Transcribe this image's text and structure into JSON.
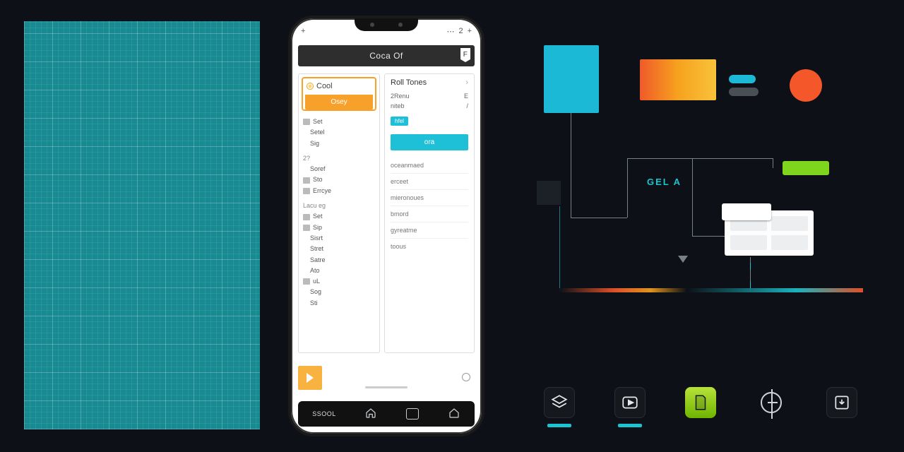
{
  "phone": {
    "statusbar": {
      "plus": "+",
      "more": "⋯",
      "tab": "2"
    },
    "titlebar": {
      "title": "Coca Of",
      "flag": "F"
    },
    "left": {
      "cool_label": "Cool",
      "cool_button": "Osey",
      "tree_section1": "2?",
      "tree_section2": "Lacu eg",
      "items": [
        "Set",
        "Setel",
        "Sig",
        "Soref",
        "Sto",
        "Errcye",
        "Set",
        "Sip",
        "Sisrt",
        "Stret",
        "Satre",
        "Ato",
        "uL",
        "Sog",
        "Sti"
      ]
    },
    "right": {
      "header": "Roll Tones",
      "chev": "›",
      "kv": [
        {
          "k": "2Renu",
          "v": "E"
        },
        {
          "k": "niteb",
          "v": "/"
        }
      ],
      "tag": "hfel",
      "button": "ora",
      "list": [
        "oceanmaed",
        "erceet",
        "mieronoues",
        "bmord",
        "gyreatme",
        "toous"
      ]
    },
    "nav_label": "SSOOL"
  },
  "canvas": {
    "brand": "GEL A"
  }
}
